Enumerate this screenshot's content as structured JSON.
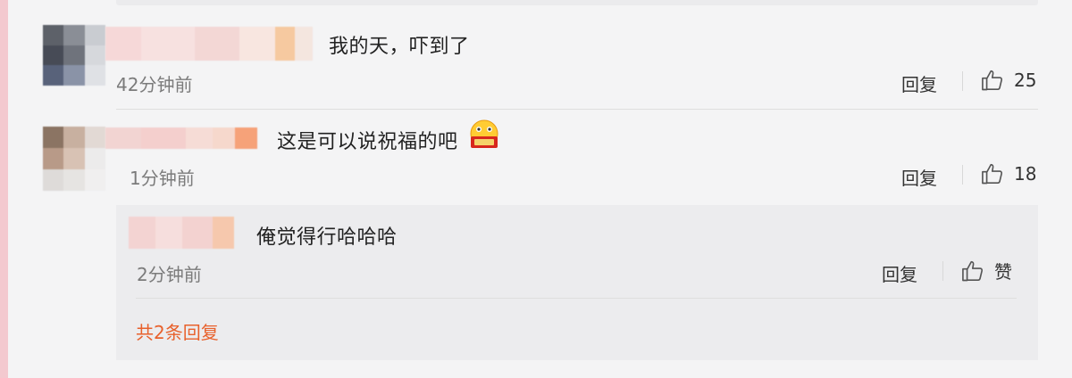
{
  "comments": [
    {
      "text": "我的天，吓到了",
      "time": "42分钟前",
      "reply_label": "回复",
      "like_icon": "thumbs-up-icon",
      "like_count": "25"
    },
    {
      "text": "这是可以说祝福的吧",
      "emoji_icon": "blessing-emoji-icon",
      "time": "1分钟前",
      "reply_label": "回复",
      "like_icon": "thumbs-up-icon",
      "like_count": "18"
    }
  ],
  "sub_reply": {
    "text": "俺觉得行哈哈哈",
    "time": "2分钟前",
    "reply_label": "回复",
    "like_icon": "thumbs-up-icon",
    "like_label": "赞"
  },
  "more_replies": "共2条回复",
  "colors": {
    "accent": "#e8612c",
    "left_stripe": "#f3c9cf"
  }
}
